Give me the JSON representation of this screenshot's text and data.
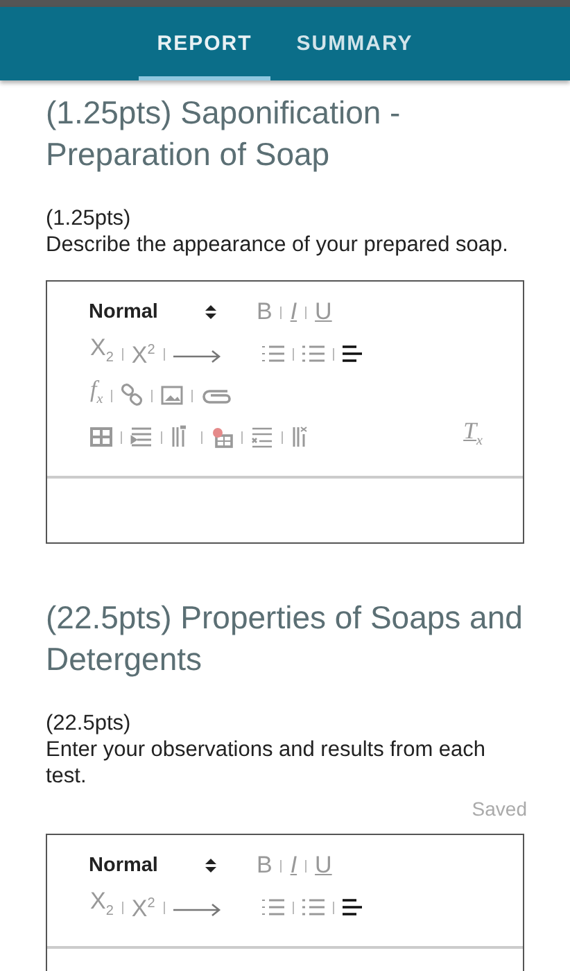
{
  "tabs": [
    {
      "label": "REPORT",
      "selected": true
    },
    {
      "label": "SUMMARY",
      "selected": false
    }
  ],
  "sections": [
    {
      "title": "(1.25pts) Saponification - Preparation of Soap",
      "points": "(1.25pts)",
      "prompt": "Describe the appearance of your prepared soap.",
      "editor": {
        "rows": [
          [
            {
              "kind": "select",
              "text": "Normal"
            },
            {
              "kind": "gap"
            },
            {
              "kind": "bold",
              "text": "B"
            },
            {
              "kind": "italic",
              "text": "I"
            },
            {
              "kind": "underline",
              "text": "U"
            }
          ],
          [
            {
              "kind": "script",
              "text": "X$_{2}$"
            },
            {
              "kind": "script",
              "text": "X$^{2}$"
            },
            {
              "kind": "arrow"
            },
            {
              "kind": "gap"
            },
            {
              "kind": "ol"
            },
            {
              "kind": "ul"
            },
            {
              "kind": "align"
            }
          ],
          [
            {
              "kind": "formula",
              "text": "f$_{x}$"
            },
            {
              "kind": "link"
            },
            {
              "kind": "image"
            },
            {
              "kind": "attach"
            }
          ],
          [
            {
              "kind": "table"
            },
            {
              "kind": "row-insert"
            },
            {
              "kind": "col-insert"
            },
            {
              "kind": "table-delete"
            },
            {
              "kind": "row-delete"
            },
            {
              "kind": "col-delete"
            },
            {
              "kind": "spacer"
            },
            {
              "kind": "clear",
              "text": "T$_{x}$"
            }
          ]
        ]
      }
    },
    {
      "title": "(22.5pts) Properties of Soaps and Detergents",
      "points": "(22.5pts)",
      "prompt": "Enter your observations and results from each test.",
      "status": "Saved",
      "editor": {
        "rows": [
          [
            {
              "kind": "select",
              "text": "Normal"
            },
            {
              "kind": "gap"
            },
            {
              "kind": "bold",
              "text": "B"
            },
            {
              "kind": "italic",
              "text": "I"
            },
            {
              "kind": "underline",
              "text": "U"
            }
          ],
          [
            {
              "kind": "script",
              "text": "X$_{2}$"
            },
            {
              "kind": "script",
              "text": "X$^{2}$"
            },
            {
              "kind": "arrow"
            },
            {
              "kind": "gap"
            },
            {
              "kind": "ol"
            },
            {
              "kind": "ul"
            },
            {
              "kind": "align"
            }
          ]
        ]
      }
    }
  ]
}
